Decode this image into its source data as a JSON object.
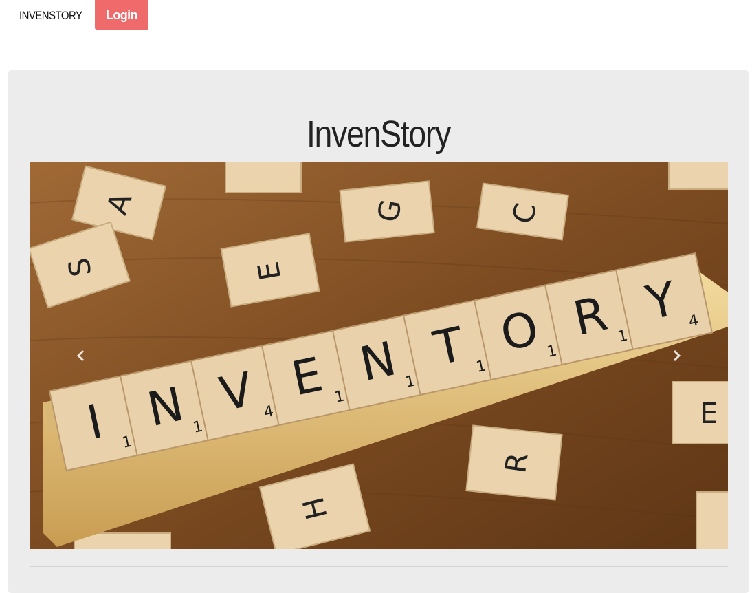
{
  "navbar": {
    "brand": "INVENSTORY",
    "login_label": "Login"
  },
  "hero": {
    "title": "InvenStory"
  },
  "carousel": {
    "image_description": "wooden letter tiles spelling INVENTORY on a rack",
    "rack_tiles": [
      {
        "letter": "I",
        "score": "1"
      },
      {
        "letter": "N",
        "score": "1"
      },
      {
        "letter": "V",
        "score": "4"
      },
      {
        "letter": "E",
        "score": "1"
      },
      {
        "letter": "N",
        "score": "1"
      },
      {
        "letter": "T",
        "score": "1"
      },
      {
        "letter": "O",
        "score": "1"
      },
      {
        "letter": "R",
        "score": "1"
      },
      {
        "letter": "Y",
        "score": "4"
      }
    ],
    "prev_icon": "chevron-left-icon",
    "next_icon": "chevron-right-icon"
  },
  "colors": {
    "login_bg": "#ef6a6a",
    "jumbotron_bg": "#ececec",
    "wood_dark": "#7a4a22",
    "tile": "#e9d2ab"
  }
}
